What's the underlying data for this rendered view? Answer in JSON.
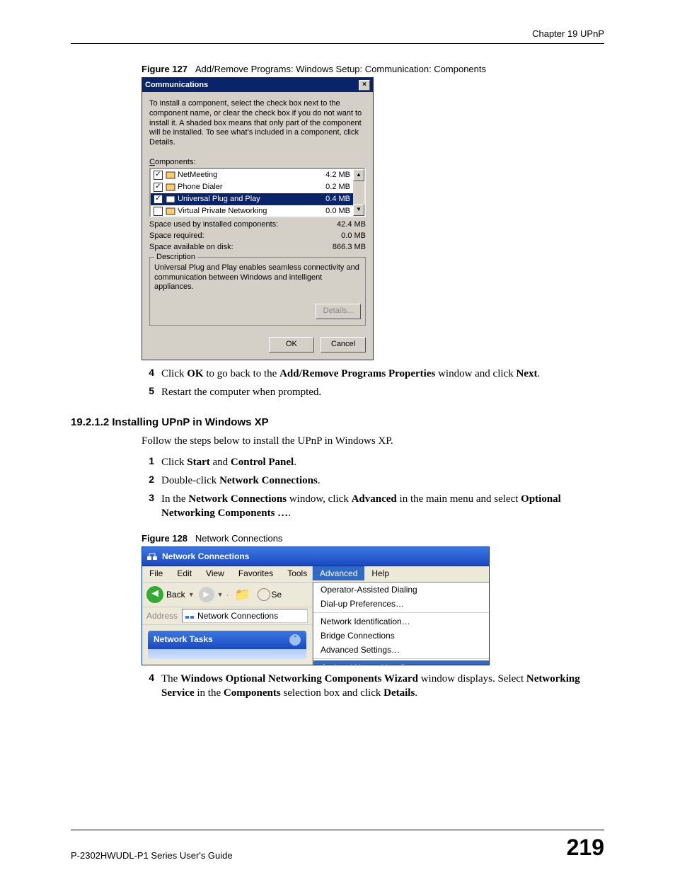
{
  "header": {
    "chapter": "Chapter 19 UPnP"
  },
  "fig127": {
    "caption_label": "Figure 127",
    "caption_text": "Add/Remove Programs: Windows Setup: Communication: Components",
    "title": "Communications",
    "instructions": "To install a component, select the check box next to the component name, or clear the check box if you do not want to install it. A shaded box means that only part of the component will be installed. To see what's included in a component, click Details.",
    "components_label": "Components:",
    "rows": [
      {
        "checked": true,
        "name": "NetMeeting",
        "size": "4.2 MB",
        "selected": false
      },
      {
        "checked": true,
        "name": "Phone Dialer",
        "size": "0.2 MB",
        "selected": false
      },
      {
        "checked": true,
        "name": "Universal Plug and Play",
        "size": "0.4 MB",
        "selected": true
      },
      {
        "checked": false,
        "name": "Virtual Private Networking",
        "size": "0.0 MB",
        "selected": false
      }
    ],
    "space_used_label": "Space used by installed components:",
    "space_used": "42.4 MB",
    "space_req_label": "Space required:",
    "space_req": "0.0 MB",
    "space_avail_label": "Space available on disk:",
    "space_avail": "866.3 MB",
    "desc_label": "Description",
    "desc_text": "Universal Plug and Play enables seamless connectivity and communication between Windows and intelligent appliances.",
    "details_btn": "Details...",
    "ok_btn": "OK",
    "cancel_btn": "Cancel"
  },
  "steps_a": {
    "4": {
      "pre": "Click ",
      "b1": "OK",
      "mid": " to go back to the ",
      "b2": "Add/Remove Programs Properties",
      "post": " window and click ",
      "b3": "Next",
      "end": "."
    },
    "5": {
      "text": "Restart the computer when prompted."
    }
  },
  "section2": {
    "heading": "19.2.1.2  Installing UPnP in Windows XP",
    "intro": "Follow the steps below to install the UPnP in Windows XP."
  },
  "steps_b": {
    "1": {
      "pre": "Click ",
      "b1": "Start",
      "mid": " and ",
      "b2": "Control Panel",
      "end": "."
    },
    "2": {
      "pre": "Double-click ",
      "b1": "Network Connections",
      "end": "."
    },
    "3": {
      "pre": "In the ",
      "b1": "Network Connections",
      "mid": " window, click ",
      "b2": "Advanced",
      "mid2": " in the main menu and select ",
      "b3": "Optional Networking Components …",
      "end": "."
    }
  },
  "fig128": {
    "caption_label": "Figure 128",
    "caption_text": "Network Connections",
    "title": "Network Connections",
    "menu_left": [
      "File",
      "Edit",
      "View",
      "Favorites",
      "Tools"
    ],
    "menu_right": [
      "Advanced",
      "Help"
    ],
    "back_label": "Back",
    "search_stub": "Se",
    "address_label": "Address",
    "address_value": "Network Connections",
    "tasks_title": "Network Tasks",
    "dropdown": [
      "Operator-Assisted Dialing",
      "Dial-up Preferences…",
      "---",
      "Network Identification…",
      "Bridge Connections",
      "Advanced Settings…",
      "---",
      "Optional Networking Components…"
    ]
  },
  "steps_c": {
    "4": {
      "pre": "The ",
      "b1": "Windows Optional Networking Components Wizard",
      "mid": " window displays. Select ",
      "b2": "Networking Service",
      "mid2": " in the ",
      "b3": "Components",
      "mid3": " selection box and click ",
      "b4": "Details",
      "end": "."
    }
  },
  "footer": {
    "guide": "P-2302HWUDL-P1 Series User's Guide",
    "page": "219"
  }
}
